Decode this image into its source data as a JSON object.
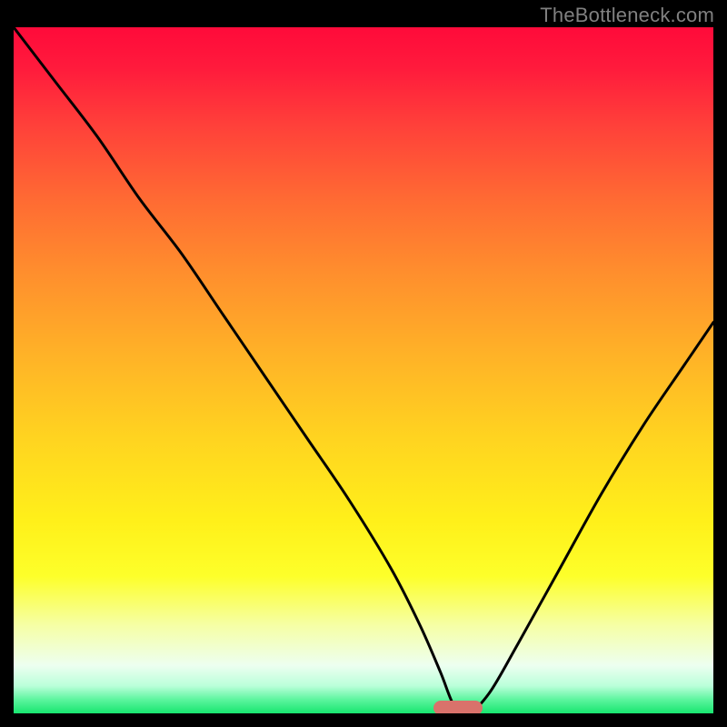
{
  "watermark": "TheBottleneck.com",
  "chart_data": {
    "type": "line",
    "title": "",
    "xlabel": "",
    "ylabel": "",
    "xlim": [
      0,
      100
    ],
    "ylim": [
      0,
      100
    ],
    "grid": false,
    "series": [
      {
        "name": "bottleneck-curve",
        "x": [
          0,
          6,
          12,
          18,
          24,
          30,
          36,
          42,
          48,
          54,
          58,
          61,
          63,
          65,
          68,
          72,
          78,
          84,
          90,
          96,
          100
        ],
        "y": [
          100,
          92,
          84,
          75,
          67,
          58,
          49,
          40,
          31,
          21,
          13,
          6,
          1,
          0,
          3,
          10,
          21,
          32,
          42,
          51,
          57
        ]
      }
    ],
    "marker": {
      "x": 63.5,
      "y": 0,
      "shape": "pill",
      "color": "#d9726b"
    },
    "background_gradient": {
      "type": "vertical",
      "stops": [
        {
          "pos": 0.0,
          "color": "#ff0a3a"
        },
        {
          "pos": 0.5,
          "color": "#ffb327"
        },
        {
          "pos": 0.8,
          "color": "#fdff2a"
        },
        {
          "pos": 1.0,
          "color": "#18e66f"
        }
      ]
    }
  },
  "colors": {
    "frame": "#000000",
    "curve": "#000000",
    "marker": "#d9726b",
    "watermark": "#808080"
  }
}
